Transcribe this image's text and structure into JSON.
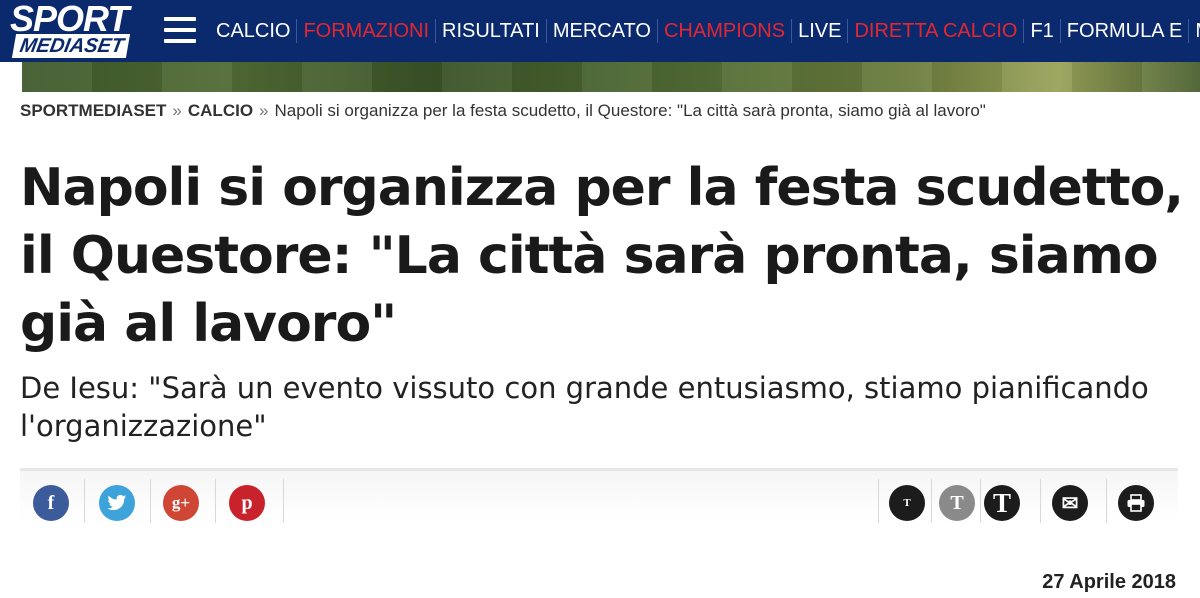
{
  "logo": {
    "top": "SPORT",
    "bottom": "MEDIASET"
  },
  "nav": {
    "items": [
      {
        "label": "CALCIO",
        "color": "#ffffff"
      },
      {
        "label": "FORMAZIONI",
        "color": "#e32630"
      },
      {
        "label": "RISULTATI",
        "color": "#ffffff"
      },
      {
        "label": "MERCATO",
        "color": "#ffffff"
      },
      {
        "label": "CHAMPIONS",
        "color": "#e32630"
      },
      {
        "label": "LIVE",
        "color": "#ffffff"
      },
      {
        "label": "DIRETTA CALCIO",
        "color": "#e32630"
      },
      {
        "label": "F1",
        "color": "#ffffff"
      },
      {
        "label": "FORMULA E",
        "color": "#ffffff"
      },
      {
        "label": "MOTOG",
        "color": "#ffffff"
      }
    ]
  },
  "breadcrumb": {
    "home": "SPORTMEDIASET",
    "separator": "»",
    "section": "CALCIO",
    "current": "Napoli si organizza per la festa scudetto, il Questore: \"La città sarà pronta, siamo già al lavoro\""
  },
  "article": {
    "title": "Napoli si organizza per la festa scudetto, il Questore: \"La città sarà pronta, siamo già al lavoro\"",
    "subtitle": "De Iesu: \"Sarà un evento vissuto con grande entusiasmo, stiamo pianificando l'organizzazione\"",
    "date": "27 Aprile 2018"
  },
  "share": {
    "social": [
      {
        "icon": "facebook-icon",
        "glyph": "f",
        "color": "#3b5b9a"
      },
      {
        "icon": "twitter-icon",
        "glyph": "t",
        "color": "#3ea3db"
      },
      {
        "icon": "google-plus-icon",
        "glyph": "g+",
        "color": "#cf4635"
      },
      {
        "icon": "pinterest-icon",
        "glyph": "p",
        "color": "#c8232c"
      }
    ],
    "tools": [
      {
        "icon": "text-small-icon",
        "glyph": "T",
        "color": "#1c1c1c"
      },
      {
        "icon": "text-medium-icon",
        "glyph": "T",
        "color": "#888888"
      },
      {
        "icon": "text-large-icon",
        "glyph": "T",
        "color": "#1c1c1c"
      },
      {
        "icon": "email-icon",
        "glyph": "✉",
        "color": "#1c1c1c"
      },
      {
        "icon": "print-icon",
        "glyph": "⎙",
        "color": "#1c1c1c"
      }
    ]
  }
}
